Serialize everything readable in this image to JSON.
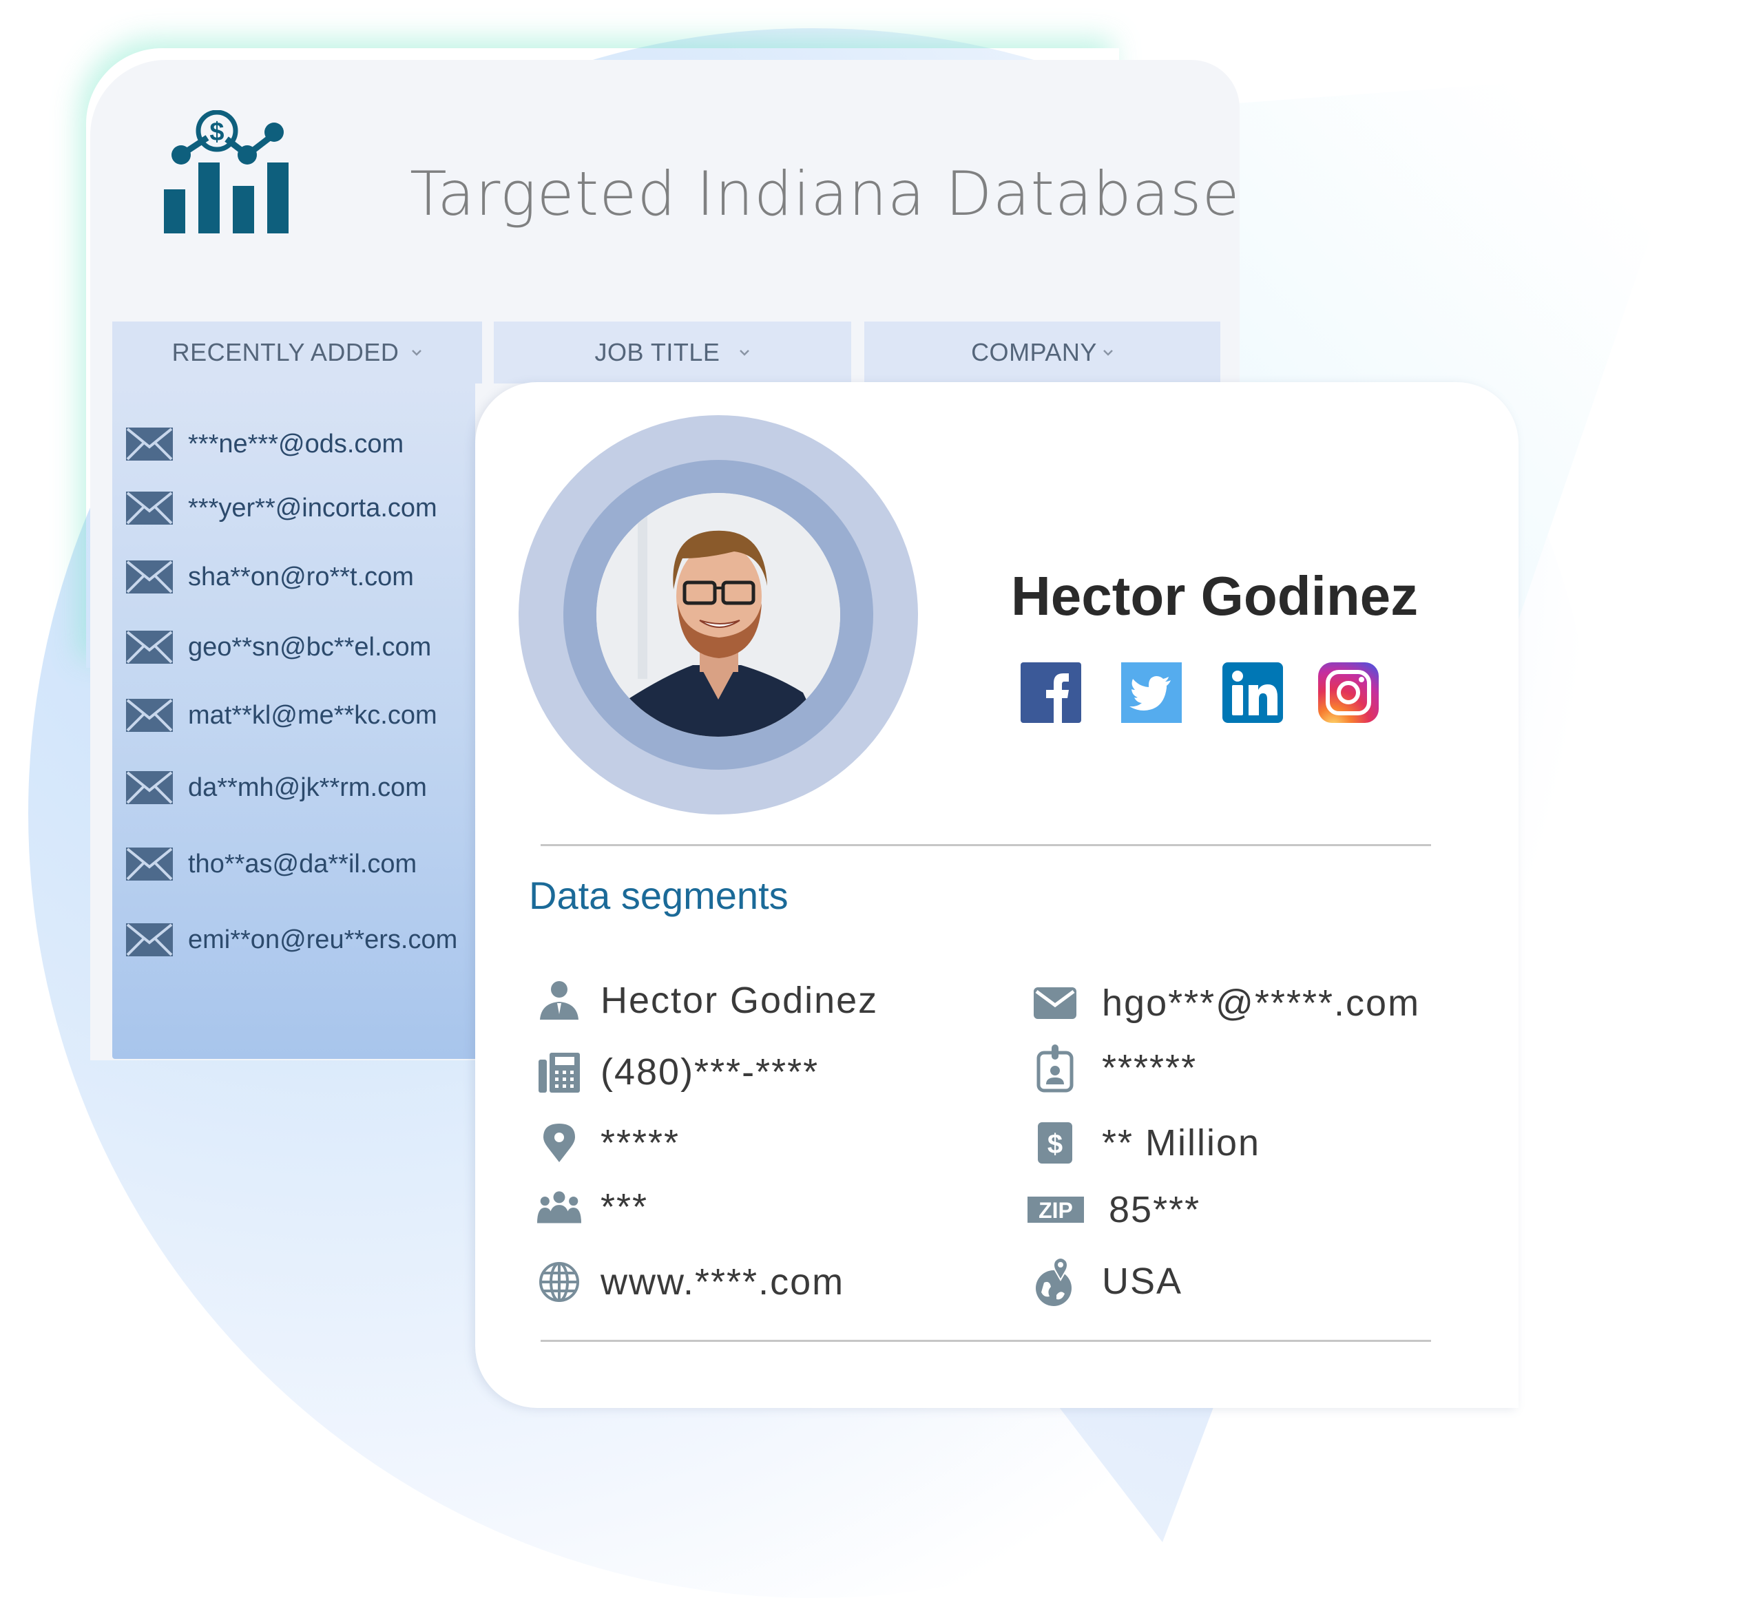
{
  "header": {
    "title": "Targeted Indiana Database",
    "logo_icon": "finance-chart-icon"
  },
  "tabs": [
    {
      "label": "RECENTLY ADDED",
      "icon": "chevron-down-icon"
    },
    {
      "label": "JOB TITLE",
      "icon": "chevron-down-icon"
    },
    {
      "label": "COMPANY",
      "icon": "chevron-down-icon"
    }
  ],
  "recent_emails": [
    "***ne***@ods.com",
    "***yer**@incorta.com",
    "sha**on@ro**t.com",
    "geo**sn@bc**el.com",
    "mat**kl@me**kc.com",
    "da**mh@jk**rm.com",
    "tho**as@da**il.com",
    "emi**on@reu**ers.com"
  ],
  "profile": {
    "name": "Hector Godinez",
    "avatar": "profile-photo",
    "social": [
      {
        "name": "facebook",
        "color": "#3b5998"
      },
      {
        "name": "twitter",
        "color": "#55acee"
      },
      {
        "name": "linkedin",
        "color": "#0077b5"
      },
      {
        "name": "instagram",
        "color": "#d6249f"
      }
    ]
  },
  "segments": {
    "title": "Data segments",
    "left": [
      {
        "icon": "person-icon",
        "value": "Hector Godinez"
      },
      {
        "icon": "phone-fax-icon",
        "value": "(480)***-****"
      },
      {
        "icon": "location-pin-icon",
        "value": "*****"
      },
      {
        "icon": "team-icon",
        "value": "***"
      },
      {
        "icon": "globe-icon",
        "value": "www.****.com"
      }
    ],
    "right": [
      {
        "icon": "email-icon",
        "value": "hgo***@*****.com"
      },
      {
        "icon": "id-badge-icon",
        "value": "******"
      },
      {
        "icon": "dollar-icon",
        "value": "** Million"
      },
      {
        "icon": "zip-icon",
        "value": "85***",
        "icon_text": "ZIP"
      },
      {
        "icon": "globe-pin-icon",
        "value": "USA"
      }
    ]
  },
  "colors": {
    "accent": "#1b6a98",
    "icon_gray": "#788d9a",
    "logo": "#0e5f7d",
    "email_icon": "#4d6a8c"
  }
}
